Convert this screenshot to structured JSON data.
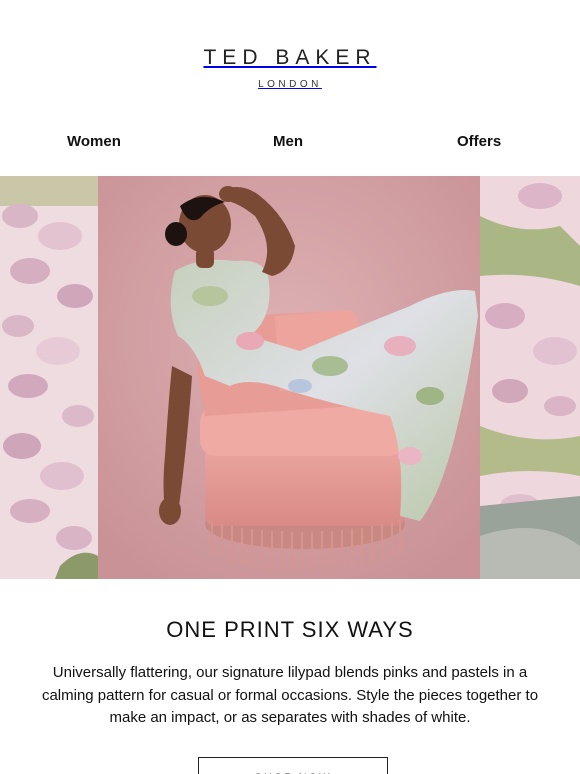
{
  "brand": {
    "name": "TED BAKER",
    "location": "LONDON"
  },
  "nav": {
    "items": [
      {
        "label": "Women"
      },
      {
        "label": "Men"
      },
      {
        "label": "Offers"
      }
    ]
  },
  "hero": {
    "image_icon": "model-in-floral-dress-on-pink-chair-image",
    "colors": {
      "backdrop": "#d9a8ab",
      "chair": "#e49a94",
      "floral_panel": "#efd6dc"
    }
  },
  "content": {
    "headline": "ONE PRINT SIX WAYS",
    "body": "Universally flattering, our signature lilypad blends pinks and pastels in a calming pattern for casual or formal occasions. Style the pieces together to make an impact, or as separates with shades of white.",
    "cta_label": "SHOP NOW"
  }
}
